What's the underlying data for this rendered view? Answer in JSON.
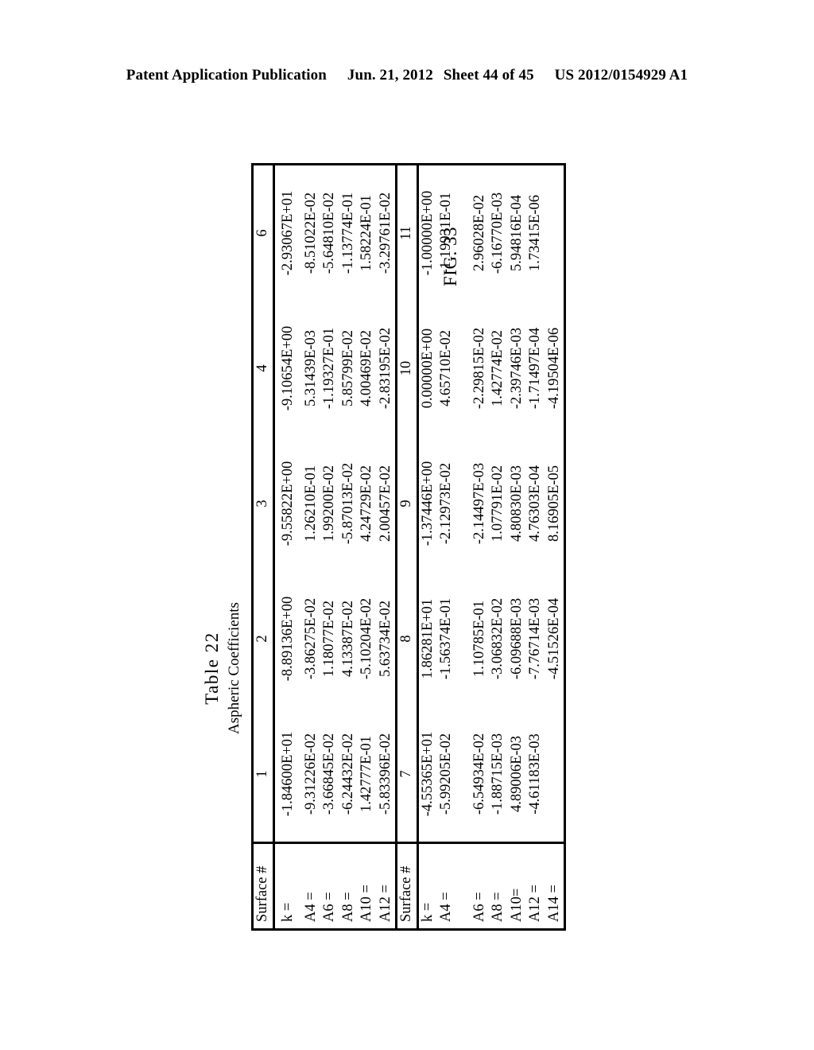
{
  "header": {
    "publication": "Patent Application Publication",
    "date": "Jun. 21, 2012",
    "sheet": "Sheet 44 of 45",
    "docnum": "US 2012/0154929 A1"
  },
  "figure": {
    "label": "FIG. 33"
  },
  "table": {
    "title": "Table 22",
    "subtitle": "Aspheric Coefficients",
    "row_header_label": "Surface #",
    "blocks": [
      {
        "id": "block-1",
        "columns": [
          "1",
          "2",
          "3",
          "4",
          "6"
        ],
        "rows": [
          {
            "label": "k =",
            "values": [
              "-1.84600E+01",
              "-8.89136E+00",
              "-9.55822E+00",
              "-9.10654E+00",
              "-2.93067E+01"
            ]
          },
          {
            "label": "A4 =",
            "values": [
              "-9.31226E-02",
              "-3.86275E-02",
              "1.26210E-01",
              "5.31439E-03",
              "-8.51022E-02"
            ]
          },
          {
            "label": "A6 =",
            "values": [
              "-3.66845E-02",
              "1.18077E-02",
              "1.99200E-02",
              "-1.19327E-01",
              "-5.64810E-02"
            ]
          },
          {
            "label": "A8 =",
            "values": [
              "-6.24432E-02",
              "4.13387E-02",
              "-5.87013E-02",
              "5.85799E-02",
              "-1.13774E-01"
            ]
          },
          {
            "label": "A10 =",
            "values": [
              "1.42777E-01",
              "-5.10204E-02",
              "4.24729E-02",
              "4.00469E-02",
              "1.58224E-01"
            ]
          },
          {
            "label": "A12 =",
            "values": [
              "-5.83396E-02",
              "5.63734E-02",
              "2.00457E-02",
              "-2.83195E-02",
              "-3.29761E-02"
            ]
          }
        ]
      },
      {
        "id": "block-2",
        "columns": [
          "7",
          "8",
          "9",
          "10",
          "11"
        ],
        "rows": [
          {
            "label": "k =",
            "values": [
              "-4.55365E+01",
              "1.86281E+01",
              "-1.37446E+00",
              "0.00000E+00",
              "-1.00000E+00"
            ]
          },
          {
            "label": "A4 =",
            "values": [
              "-5.99205E-02",
              "-1.56374E-01",
              "-2.12973E-02",
              "4.65710E-02",
              "-1.19931E-01"
            ]
          },
          {
            "label": "A6 =",
            "values": [
              "-6.54934E-02",
              "1.10785E-01",
              "-2.14497E-03",
              "-2.29815E-02",
              "2.96028E-02"
            ]
          },
          {
            "label": "A8 =",
            "values": [
              "-1.88715E-03",
              "-3.06832E-02",
              "1.07791E-02",
              "1.42774E-02",
              "-6.16770E-03"
            ]
          },
          {
            "label": "A10=",
            "values": [
              "4.89006E-03",
              "-6.09688E-03",
              "4.80830E-03",
              "-2.39746E-03",
              "5.94816E-04"
            ]
          },
          {
            "label": "A12 =",
            "values": [
              "-4.61183E-03",
              "-7.76714E-03",
              "4.76303E-04",
              "-1.71497E-04",
              "1.73415E-06"
            ]
          },
          {
            "label": "A14 =",
            "values": [
              "",
              "-4.51526E-04",
              "8.16905E-05",
              "-4.19504E-06",
              ""
            ]
          }
        ]
      }
    ]
  }
}
